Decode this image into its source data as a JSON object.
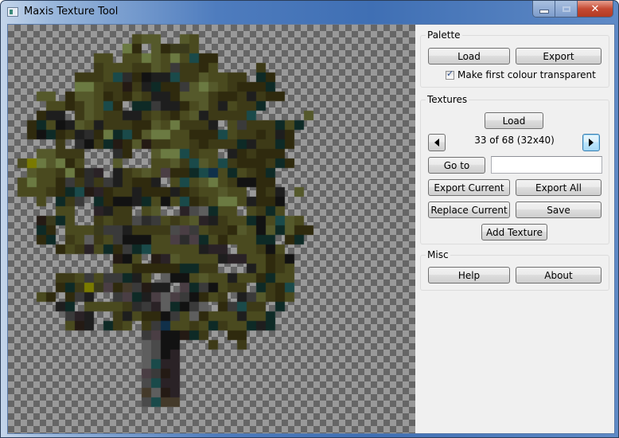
{
  "window": {
    "title": "Maxis Texture Tool",
    "controls": {
      "minimize": "minimize-icon",
      "maximize": "maximize-icon",
      "close": "close-icon",
      "close_glyph": "✕"
    }
  },
  "palette": {
    "group_label": "Palette",
    "load_label": "Load",
    "export_label": "Export",
    "transparent_checkbox_label": "Make first colour transparent",
    "transparent_checked": true,
    "check_glyph": "✓"
  },
  "textures": {
    "group_label": "Textures",
    "load_label": "Load",
    "prev_icon": "triangle-left-icon",
    "next_icon": "triangle-right-icon",
    "status": "33 of 68 (32x40)",
    "current_index": 33,
    "total": 68,
    "width": 32,
    "height": 40,
    "goto_label": "Go to",
    "goto_value": "",
    "export_current_label": "Export Current",
    "export_all_label": "Export All",
    "replace_current_label": "Replace Current",
    "save_label": "Save",
    "add_texture_label": "Add Texture"
  },
  "misc": {
    "group_label": "Misc",
    "help_label": "Help",
    "about_label": "About"
  },
  "texture_image": {
    "cols": 32,
    "rows": 40,
    "palette": {
      ".": null,
      "a": "#3d3a17",
      "b": "#4a4a1f",
      "c": "#55592b",
      "d": "#6b7a42",
      "e": "#2f2a0e",
      "f": "#1e1e1e",
      "g": "#0e2a26",
      "h": "#1a4a4a",
      "i": "#2c2c2c",
      "j": "#3a3a3a",
      "k": "#121212",
      "l": "#241a14",
      "m": "#3a3a1c",
      "n": "#7a7a00",
      "o": "#4a4a4a",
      "p": "#5e5e5e",
      "q": "#4a3e44",
      "r": "#2a2226",
      "s": "#10304a",
      "t": "#443a2a"
    },
    "rows_data": [
      "................................",
      ".............bcc..cb............",
      "............de.cemmb............",
      ".........bb.bbdcbdbhee..........",
      ".........abbbaacbjaaeb....a.....",
      ".......aaabhiekffhaacbbaa.ge....",
      ".......ddbaalafgeejcdcbaeeeg....",
      "...cc.eccbeaebaffecccaeeafaee...",
      "....bbeacbhe.ggjffebcafbaag.....",
      "...eff.acbaaffabaebcfaaaah.....cc",
      "..egbkfcbfaaaeecbdaaaf.bjaaagbg.",
      "..ekgeafiedghecddbbeeehbaaeafe..",
      ".....a.ikagleclaabbaeaaagfaage..",
      "...ccaaa...ie..cddhabb.feaeee...",
      ".bndcdeb...c...bbcahcbhaeeeage..",
      "..cbbadeir.fabcbqeeghsbgbaeg....",
      ".bdbbejaiajfaeef.bhbcdbakkee....",
      ".bbbaeghlreaafeeefeabbcbb.eaf.c.",
      "...b.gaj.gekkfgbkbheabddbfeek...",
      ".....bb..rfaa.bc..ropgbb.bagb...",
      "...lmgb..abaaoijbabcrfabbgkbhcb.",
      "...ge.bbbmjjfaaaaoqjbaaecbkcgceee",
      "...eg.abpabjkkkbbqiqgbebbbgg.eg.",
      ".....ebarbgejghbbbbbfrr.bbakb...",
      "...........lkb.lrcbbbbfrrbbeak..",
      "...........bbeeeeeggaa...fbeab..",
      ".....aabjbjjgfb.pkkbcbbfbbegbb..",
      ".....eganmqetjlff.qgjkbaa.gaeh..",
      "...be.ejf..jqgfqpqjkeba.fjcaeb..",
      ".....fg.bbbbaijrpgkjp.ejhaa.g...",
      "......jrf..afbeekjbpebbbfbbg....",
      "......blf.gab.ajsbbabgabbgfg....",
      "..............jqkklga..ee.......",
      "..............pokk...a..a.......",
      "..............pokr..............",
      "..............phrr..............",
      "..............qjlr..............",
      "..............ohrr..............",
      "..............tplr..............",
      "..............ohtt.............."
    ]
  }
}
